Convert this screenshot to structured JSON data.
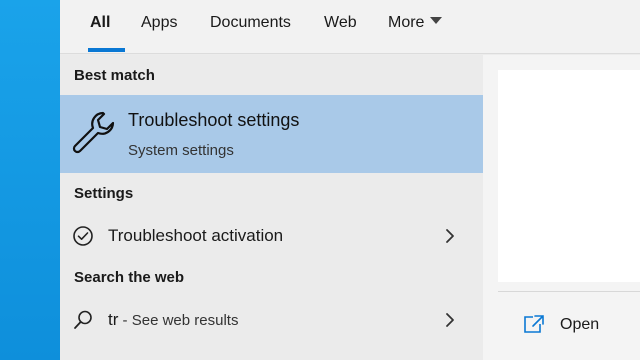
{
  "tabs": [
    {
      "label": "All"
    },
    {
      "label": "Apps"
    },
    {
      "label": "Documents"
    },
    {
      "label": "Web"
    },
    {
      "label": "More"
    }
  ],
  "sections": {
    "best_match": "Best match",
    "settings": "Settings",
    "search_web": "Search the web"
  },
  "best_match": {
    "title": "Troubleshoot settings",
    "subtitle": "System settings",
    "icon": "wrench-icon"
  },
  "settings_items": [
    {
      "label": "Troubleshoot activation",
      "icon": "check-circle-icon"
    }
  ],
  "web_item": {
    "query": "tr",
    "suffix": " - See web results",
    "icon": "search-icon"
  },
  "preview": {
    "open_label": "Open"
  },
  "colors": {
    "accent": "#0a78d4",
    "selected": "#a9c9e8",
    "desktop": "#1aa3ea"
  }
}
